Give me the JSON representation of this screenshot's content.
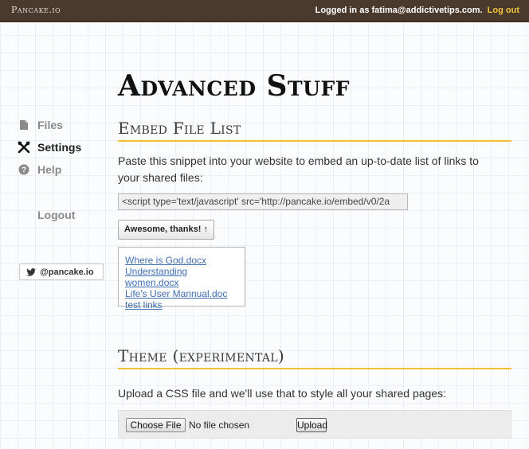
{
  "header": {
    "brand": "Pancake.io",
    "logged_in_text": "Logged in as fatima@addictivetips.com.",
    "logout_link": "Log out"
  },
  "sidebar": {
    "items": [
      {
        "label": "Files",
        "icon": "file-icon",
        "active": false
      },
      {
        "label": "Settings",
        "icon": "wrench-icon",
        "active": true
      },
      {
        "label": "Help",
        "icon": "question-circle-icon",
        "active": false
      }
    ],
    "logout": "Logout",
    "twitter": {
      "label": "@pancake.io",
      "icon": "twitter-bird-icon"
    }
  },
  "main": {
    "title": "Advanced Stuff",
    "embed": {
      "title": "Embed File List",
      "description": "Paste this snippet into your website to embed an up-to-date list of links to your shared files:",
      "snippet": "<script type='text/javascript' src='http://pancake.io/embed/v0/2a",
      "button": "Awesome, thanks! ↑",
      "links": [
        "Where is God.docx",
        "Understanding women.docx",
        "Life's User Mannual.doc",
        "test links"
      ]
    },
    "theme": {
      "title": "Theme (experimental)",
      "description": "Upload a CSS file and we'll use that to style all your shared pages:",
      "choose_file": "Choose File",
      "no_file": "No file chosen",
      "upload": "Upload"
    }
  },
  "colors": {
    "topbar": "#4a3a2e",
    "accent_underline": "#f0bf34",
    "logout_link": "#f0c33a",
    "link": "#3f6fb4"
  }
}
